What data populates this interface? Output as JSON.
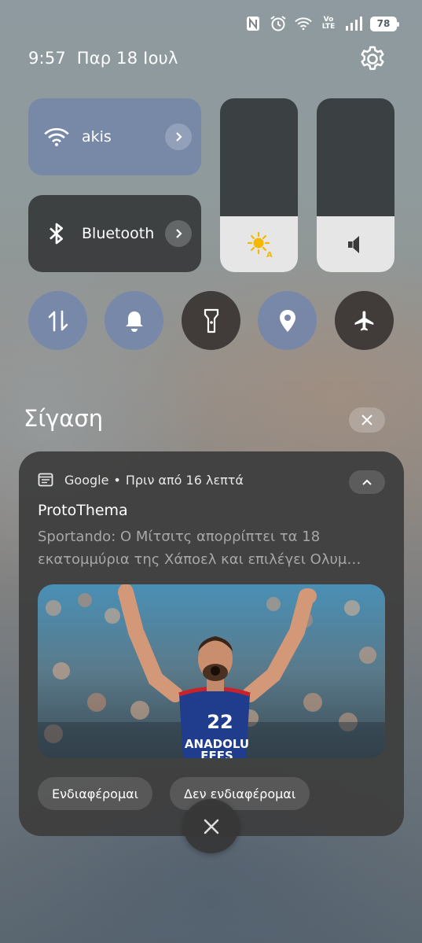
{
  "status_bar": {
    "icons": [
      "nfc-icon",
      "alarm-icon",
      "wifi-icon",
      "volte-icon",
      "signal-icon"
    ],
    "volte_top": "Vo",
    "volte_bottom": "LTE",
    "battery": "78"
  },
  "header": {
    "time": "9:57",
    "date": "Παρ 18 Ιουλ"
  },
  "quick_settings": {
    "wifi": {
      "label": "akis",
      "icon": "wifi-icon",
      "state": "on"
    },
    "bluetooth": {
      "label": "Bluetooth",
      "icon": "bluetooth-icon",
      "state": "off"
    },
    "brightness_level": 0.32,
    "volume_level": 0.32,
    "toggles": [
      {
        "name": "mobile-data",
        "icon": "data-arrows-icon",
        "state": "on"
      },
      {
        "name": "sound",
        "icon": "bell-icon",
        "state": "on"
      },
      {
        "name": "flashlight",
        "icon": "flashlight-icon",
        "state": "off"
      },
      {
        "name": "location",
        "icon": "location-icon",
        "state": "on"
      },
      {
        "name": "airplane-mode",
        "icon": "airplane-icon",
        "state": "off"
      }
    ]
  },
  "section": {
    "title": "Σίγαση"
  },
  "notification": {
    "app": "Google",
    "separator": "•",
    "time": "Πριν από 16 λεπτά",
    "title": "ProtoThema",
    "body": "Sportando: Ο Μίτσιτς απορρίπτει τα 18 εκατομμύρια της Χάπoελ και επιλέγει Ολυμ…",
    "image": {
      "jersey_number": "22",
      "jersey_text_1": "ANADOLU",
      "jersey_text_2": "EFES"
    },
    "actions": [
      "Ενδιαφέρομαι",
      "Δεν ενδιαφέρομαι"
    ]
  },
  "colors": {
    "tile_on": "#7687aa",
    "tile_off": "#323436",
    "brightness_icon": "#f5b800"
  }
}
